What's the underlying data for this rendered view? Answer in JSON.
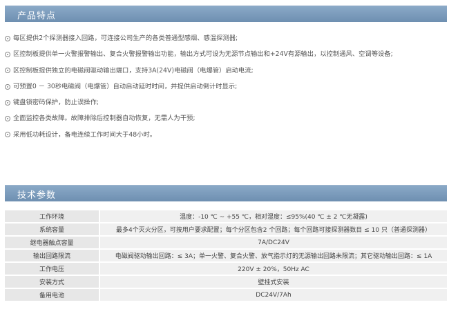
{
  "section1": {
    "title": "产品特点"
  },
  "features": [
    "每区提供2个探测器接入回路，可连接公司生产的各类普通型感烟、感温探测器;",
    "区控制板提供单一火警报警输出、复合火警报警输出功能，输出方式可设为无源节点输出和+24V有源输出，以控制通风、空调等设备;",
    "区控制板提供独立的电磁阀驱动输出端口，支持3A(24V)电磁阀（电爆管）启动电流;",
    "可预置0 － 30秒电磁阀（电爆管）自动启动延时时间，并提供启动倒计时显示;",
    "键盘锁密码保护，防止误操作;",
    "全面监控各类故障。故障排除后控制器自动恢复，无需人为干预;",
    "采用低功耗设计，备电连续工作时间大于48小时。"
  ],
  "section2": {
    "title": "技术参数"
  },
  "specs": [
    {
      "label": "工作环境",
      "value": "温度：-10 ℃ ~ +55 ℃，相对湿度：≤95%(40 ℃ ± 2 ℃无凝露)"
    },
    {
      "label": "系统容量",
      "value": "最多4个灭火分区，可按用户要求配置；每个分区包含2 个回路；每个回路可接探测器数目 ≤ 10 只（普通探测器）"
    },
    {
      "label": "继电器触点容量",
      "value": "7A/DC24V"
    },
    {
      "label": "输出回路限流",
      "value": "电磁阀驱动输出回路：≤ 3A；单一火警、复合火警、放气指示灯的无源输出回路未限流；其它驱动输出回路：≤ 1A"
    },
    {
      "label": "工作电压",
      "value": "220V ± 20%，50Hz AC"
    },
    {
      "label": "安装方式",
      "value": "壁挂式安装"
    },
    {
      "label": "备用电池",
      "value": "DC24V/7Ah"
    }
  ]
}
